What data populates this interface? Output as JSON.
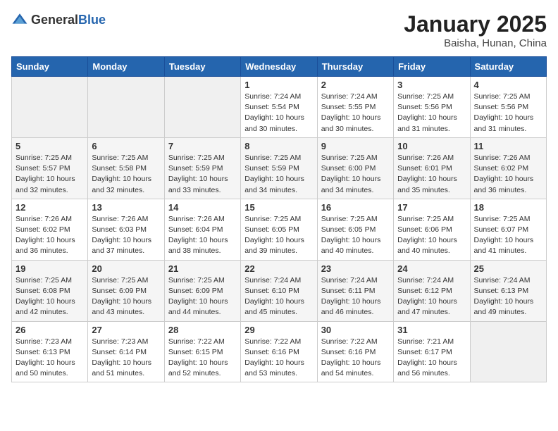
{
  "logo": {
    "text_general": "General",
    "text_blue": "Blue"
  },
  "title": "January 2025",
  "subtitle": "Baisha, Hunan, China",
  "weekdays": [
    "Sunday",
    "Monday",
    "Tuesday",
    "Wednesday",
    "Thursday",
    "Friday",
    "Saturday"
  ],
  "weeks": [
    [
      {
        "day": "",
        "info": ""
      },
      {
        "day": "",
        "info": ""
      },
      {
        "day": "",
        "info": ""
      },
      {
        "day": "1",
        "info": "Sunrise: 7:24 AM\nSunset: 5:54 PM\nDaylight: 10 hours and 30 minutes."
      },
      {
        "day": "2",
        "info": "Sunrise: 7:24 AM\nSunset: 5:55 PM\nDaylight: 10 hours and 30 minutes."
      },
      {
        "day": "3",
        "info": "Sunrise: 7:25 AM\nSunset: 5:56 PM\nDaylight: 10 hours and 31 minutes."
      },
      {
        "day": "4",
        "info": "Sunrise: 7:25 AM\nSunset: 5:56 PM\nDaylight: 10 hours and 31 minutes."
      }
    ],
    [
      {
        "day": "5",
        "info": "Sunrise: 7:25 AM\nSunset: 5:57 PM\nDaylight: 10 hours and 32 minutes."
      },
      {
        "day": "6",
        "info": "Sunrise: 7:25 AM\nSunset: 5:58 PM\nDaylight: 10 hours and 32 minutes."
      },
      {
        "day": "7",
        "info": "Sunrise: 7:25 AM\nSunset: 5:59 PM\nDaylight: 10 hours and 33 minutes."
      },
      {
        "day": "8",
        "info": "Sunrise: 7:25 AM\nSunset: 5:59 PM\nDaylight: 10 hours and 34 minutes."
      },
      {
        "day": "9",
        "info": "Sunrise: 7:25 AM\nSunset: 6:00 PM\nDaylight: 10 hours and 34 minutes."
      },
      {
        "day": "10",
        "info": "Sunrise: 7:26 AM\nSunset: 6:01 PM\nDaylight: 10 hours and 35 minutes."
      },
      {
        "day": "11",
        "info": "Sunrise: 7:26 AM\nSunset: 6:02 PM\nDaylight: 10 hours and 36 minutes."
      }
    ],
    [
      {
        "day": "12",
        "info": "Sunrise: 7:26 AM\nSunset: 6:02 PM\nDaylight: 10 hours and 36 minutes."
      },
      {
        "day": "13",
        "info": "Sunrise: 7:26 AM\nSunset: 6:03 PM\nDaylight: 10 hours and 37 minutes."
      },
      {
        "day": "14",
        "info": "Sunrise: 7:26 AM\nSunset: 6:04 PM\nDaylight: 10 hours and 38 minutes."
      },
      {
        "day": "15",
        "info": "Sunrise: 7:25 AM\nSunset: 6:05 PM\nDaylight: 10 hours and 39 minutes."
      },
      {
        "day": "16",
        "info": "Sunrise: 7:25 AM\nSunset: 6:05 PM\nDaylight: 10 hours and 40 minutes."
      },
      {
        "day": "17",
        "info": "Sunrise: 7:25 AM\nSunset: 6:06 PM\nDaylight: 10 hours and 40 minutes."
      },
      {
        "day": "18",
        "info": "Sunrise: 7:25 AM\nSunset: 6:07 PM\nDaylight: 10 hours and 41 minutes."
      }
    ],
    [
      {
        "day": "19",
        "info": "Sunrise: 7:25 AM\nSunset: 6:08 PM\nDaylight: 10 hours and 42 minutes."
      },
      {
        "day": "20",
        "info": "Sunrise: 7:25 AM\nSunset: 6:09 PM\nDaylight: 10 hours and 43 minutes."
      },
      {
        "day": "21",
        "info": "Sunrise: 7:25 AM\nSunset: 6:09 PM\nDaylight: 10 hours and 44 minutes."
      },
      {
        "day": "22",
        "info": "Sunrise: 7:24 AM\nSunset: 6:10 PM\nDaylight: 10 hours and 45 minutes."
      },
      {
        "day": "23",
        "info": "Sunrise: 7:24 AM\nSunset: 6:11 PM\nDaylight: 10 hours and 46 minutes."
      },
      {
        "day": "24",
        "info": "Sunrise: 7:24 AM\nSunset: 6:12 PM\nDaylight: 10 hours and 47 minutes."
      },
      {
        "day": "25",
        "info": "Sunrise: 7:24 AM\nSunset: 6:13 PM\nDaylight: 10 hours and 49 minutes."
      }
    ],
    [
      {
        "day": "26",
        "info": "Sunrise: 7:23 AM\nSunset: 6:13 PM\nDaylight: 10 hours and 50 minutes."
      },
      {
        "day": "27",
        "info": "Sunrise: 7:23 AM\nSunset: 6:14 PM\nDaylight: 10 hours and 51 minutes."
      },
      {
        "day": "28",
        "info": "Sunrise: 7:22 AM\nSunset: 6:15 PM\nDaylight: 10 hours and 52 minutes."
      },
      {
        "day": "29",
        "info": "Sunrise: 7:22 AM\nSunset: 6:16 PM\nDaylight: 10 hours and 53 minutes."
      },
      {
        "day": "30",
        "info": "Sunrise: 7:22 AM\nSunset: 6:16 PM\nDaylight: 10 hours and 54 minutes."
      },
      {
        "day": "31",
        "info": "Sunrise: 7:21 AM\nSunset: 6:17 PM\nDaylight: 10 hours and 56 minutes."
      },
      {
        "day": "",
        "info": ""
      }
    ]
  ]
}
